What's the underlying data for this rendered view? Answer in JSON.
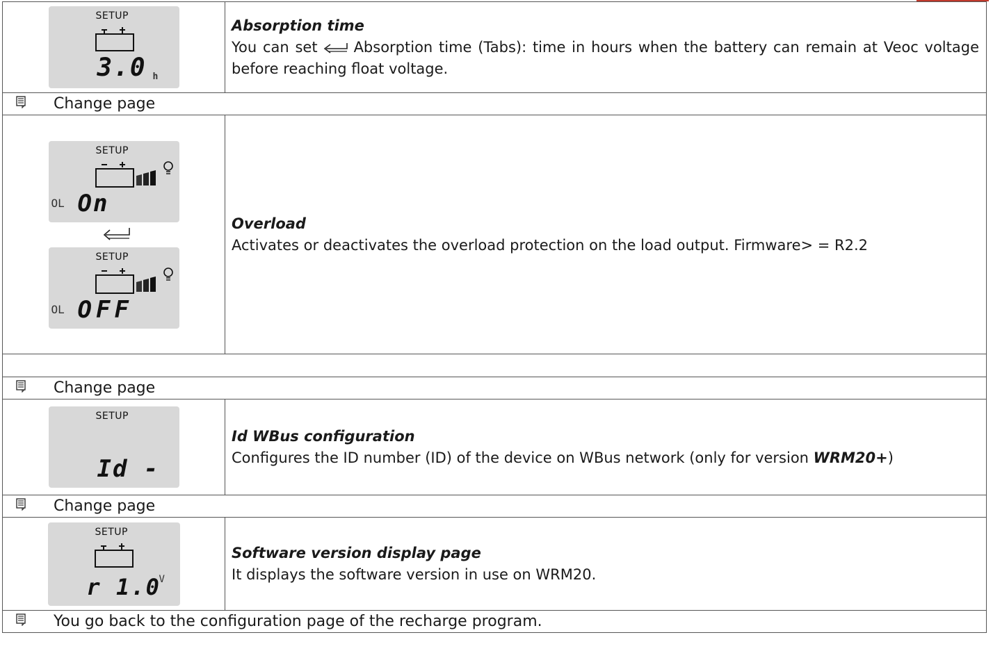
{
  "rows": {
    "absorption": {
      "lcd_label": "SETUP",
      "lcd_value": "3.0",
      "lcd_unit": "h",
      "title": "Absorption time",
      "desc_before": "You can set",
      "desc_after": "Absorption time (Tabs): time in hours when the battery can remain at Veoc voltage before reaching float voltage."
    },
    "overload": {
      "lcd_on": {
        "label": "SETUP",
        "prefix": "OL",
        "value": "On"
      },
      "lcd_off": {
        "label": "SETUP",
        "prefix": "OL",
        "value": "OFF"
      },
      "title": "Overload",
      "desc": "Activates or deactivates the overload protection on the load output. Firmware> = R2.2"
    },
    "idwbus": {
      "lcd_label": "SETUP",
      "lcd_value": "Id -",
      "title": "Id WBus configuration",
      "desc_before": "Configures the ID number (ID) of the device on WBus network (only for version ",
      "desc_bold": "WRM20+",
      "desc_after": ")"
    },
    "software": {
      "lcd_label": "SETUP",
      "lcd_value": "r 1.0",
      "lcd_unit": "V",
      "title": "Software version display page",
      "desc": "It displays the software version in use on WRM20."
    }
  },
  "notes": {
    "change_page_1": "Change page",
    "change_page_2": "Change page",
    "change_page_3": "Change page",
    "back": "You go back to the configuration page of the recharge program."
  },
  "icons": {
    "note": "page-icon",
    "enter": "enter-arrow-icon",
    "battery": "battery-icon",
    "bulb": "bulb-icon"
  },
  "colors": {
    "lcd_bg": "#d8d8d8",
    "border": "#555555",
    "accent": "#c0392b"
  }
}
